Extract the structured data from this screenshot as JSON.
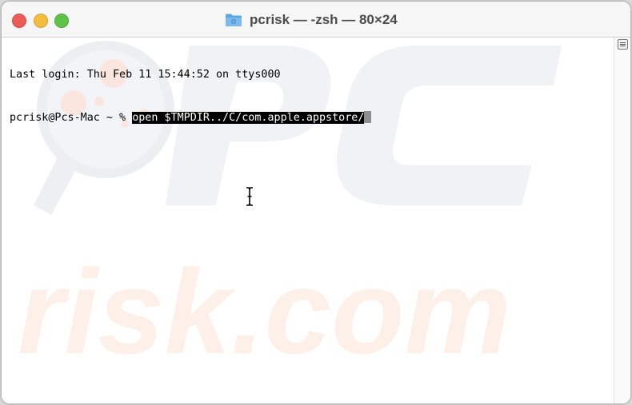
{
  "window": {
    "title": "pcrisk — -zsh — 80×24"
  },
  "terminal": {
    "lines": [
      "Last login: Thu Feb 11 15:44:52 on ttys000"
    ],
    "prompt": "pcrisk@Pcs-Mac ~ % ",
    "command": "open $TMPDIR../C/com.apple.appstore/"
  },
  "watermark": {
    "text": "risk.com"
  },
  "colors": {
    "close": "#ec5d59",
    "minimize": "#f3bd3e",
    "maximize": "#5fc445",
    "watermark_gray": "#eef0f3",
    "watermark_orange": "#fdeee5"
  },
  "icons": [
    "folder-icon",
    "text-cursor-icon",
    "scroll-menu-icon"
  ]
}
